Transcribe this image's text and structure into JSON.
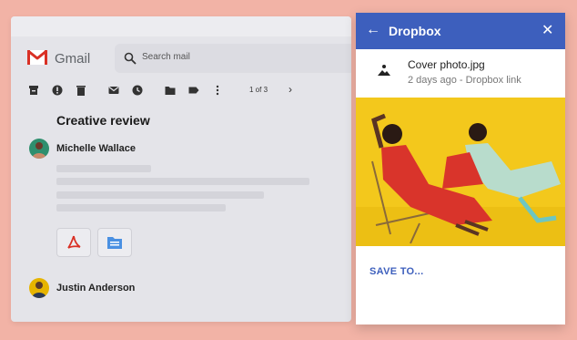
{
  "gmail": {
    "app_name": "Gmail",
    "search_placeholder": "Search mail",
    "pager": "1 of 3",
    "email": {
      "subject": "Creative review",
      "sender1": "Michelle Wallace",
      "sender2": "Justin Anderson"
    },
    "toolbar_icons": [
      "archive-icon",
      "report-spam-icon",
      "delete-icon",
      "mark-unread-icon",
      "snooze-icon",
      "move-to-icon",
      "label-icon",
      "more-icon"
    ],
    "attachment_icons": [
      "pdf-icon",
      "folder-icon"
    ]
  },
  "dropbox": {
    "title": "Dropbox",
    "file_name": "Cover photo.jpg",
    "file_meta": "2 days ago - Dropbox link",
    "save_label": "SAVE TO...",
    "header_color": "#3d5fbd"
  }
}
